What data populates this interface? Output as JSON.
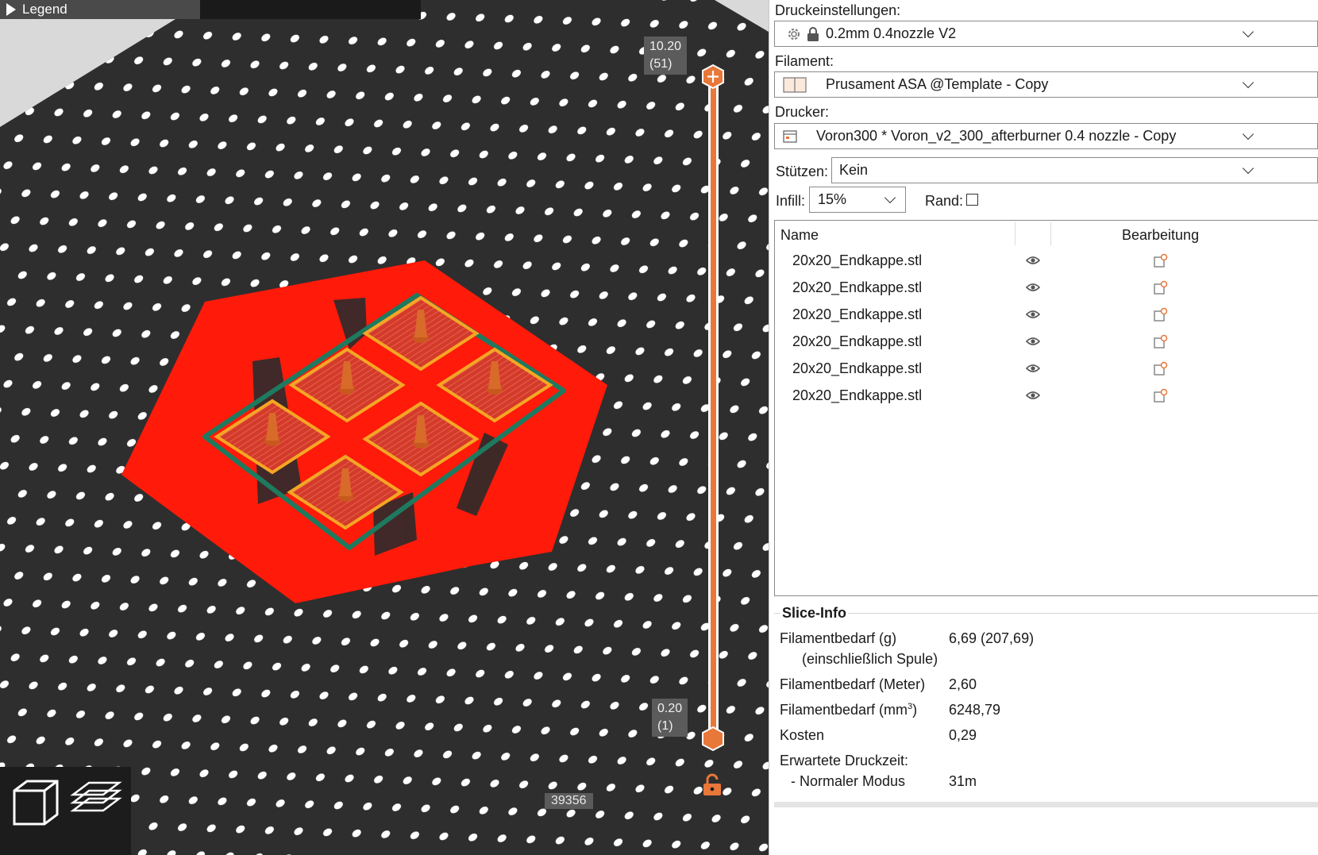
{
  "viewport": {
    "legend_label": "Legend",
    "layer_top": {
      "height": "10.20",
      "layer": "(51)"
    },
    "layer_bottom": {
      "height": "0.20",
      "layer": "(1)"
    },
    "bottom_count": "39356",
    "colors": {
      "bed": "#2e2e2e",
      "skirt_area": "#ff0000",
      "perimeter": "#f5a623",
      "travel": "#1e7a5f",
      "slider": "#e8773a"
    },
    "icons": [
      "view-cube-icon",
      "layers-view-icon",
      "unlock-icon"
    ]
  },
  "panel": {
    "print_settings_label": "Druckeinstellungen:",
    "print_settings_value": "0.2mm 0.4nozzle V2",
    "filament_label": "Filament:",
    "filament_value": "Prusament ASA @Template - Copy",
    "printer_label": "Drucker:",
    "printer_value": "Voron300 * Voron_v2_300_afterburner 0.4 nozzle - Copy",
    "supports_label": "Stützen:",
    "supports_value": "Kein",
    "infill_label": "Infill:",
    "infill_value": "15%",
    "brim_label": "Rand:",
    "brim_checked": false
  },
  "object_list": {
    "col_name": "Name",
    "col_edit": "Bearbeitung",
    "rows": [
      {
        "name": "20x20_Endkappe.stl"
      },
      {
        "name": "20x20_Endkappe.stl"
      },
      {
        "name": "20x20_Endkappe.stl"
      },
      {
        "name": "20x20_Endkappe.stl"
      },
      {
        "name": "20x20_Endkappe.stl"
      },
      {
        "name": "20x20_Endkappe.stl"
      }
    ]
  },
  "slice_info": {
    "title": "Slice-Info",
    "filament_g_label": "Filamentbedarf (g)",
    "filament_g_sub": "(einschließlich Spule)",
    "filament_g_value": "6,69 (207,69)",
    "filament_m_label": "Filamentbedarf (Meter)",
    "filament_m_value": "2,60",
    "filament_mm3_label": "Filamentbedarf (mm",
    "filament_mm3_sup": "3",
    "filament_mm3_close": ")",
    "filament_mm3_value": "6248,79",
    "cost_label": "Kosten",
    "cost_value": "0,29",
    "print_time_label": "Erwartete Druckzeit:",
    "normal_mode_label": "- Normaler Modus",
    "normal_mode_value": "31m"
  }
}
